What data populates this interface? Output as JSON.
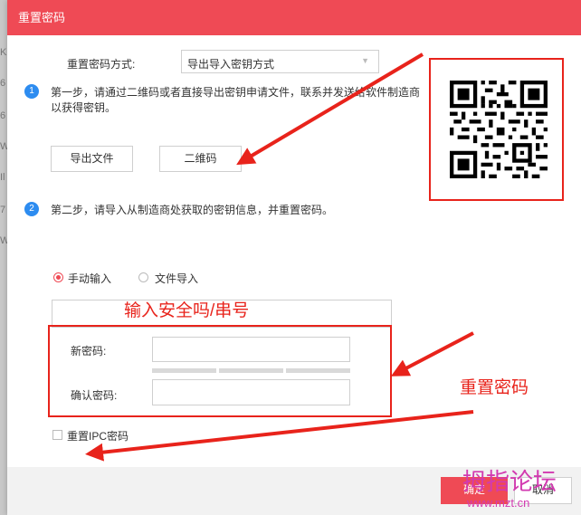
{
  "background_chars": [
    "K",
    "6",
    "6",
    "W",
    "Il",
    "7",
    "W"
  ],
  "dialog": {
    "title": "重置密码",
    "method_label": "重置密码方式:",
    "method_value": "导出导入密钥方式",
    "step1_num": "1",
    "step1_text_line1": "第一步，请通过二维码或者直接导出密钥申请文件，联系并发送给软件制造商",
    "step1_text_line2": "以获得密钥。",
    "export_button": "导出文件",
    "qrcode_button": "二维码",
    "step2_num": "2",
    "step2_text": "第二步，请导入从制造商处获取的密钥信息，并重置密码。",
    "radio_manual": "手动输入",
    "radio_file": "文件导入",
    "new_password_label": "新密码:",
    "confirm_password_label": "确认密码:",
    "reset_ipc_label": "重置IPC密码",
    "ok_button": "确定",
    "cancel_button": "取消"
  },
  "annotations": {
    "serial_hint": "输入安全吗/串号",
    "reset_hint": "重置密码"
  },
  "watermark": {
    "title": "拇指论坛",
    "url": "www.mzt.cn"
  },
  "colors": {
    "title_bar": "#ef4a55",
    "step_dot": "#2d8cf0",
    "annotation_red": "#e8231b"
  }
}
